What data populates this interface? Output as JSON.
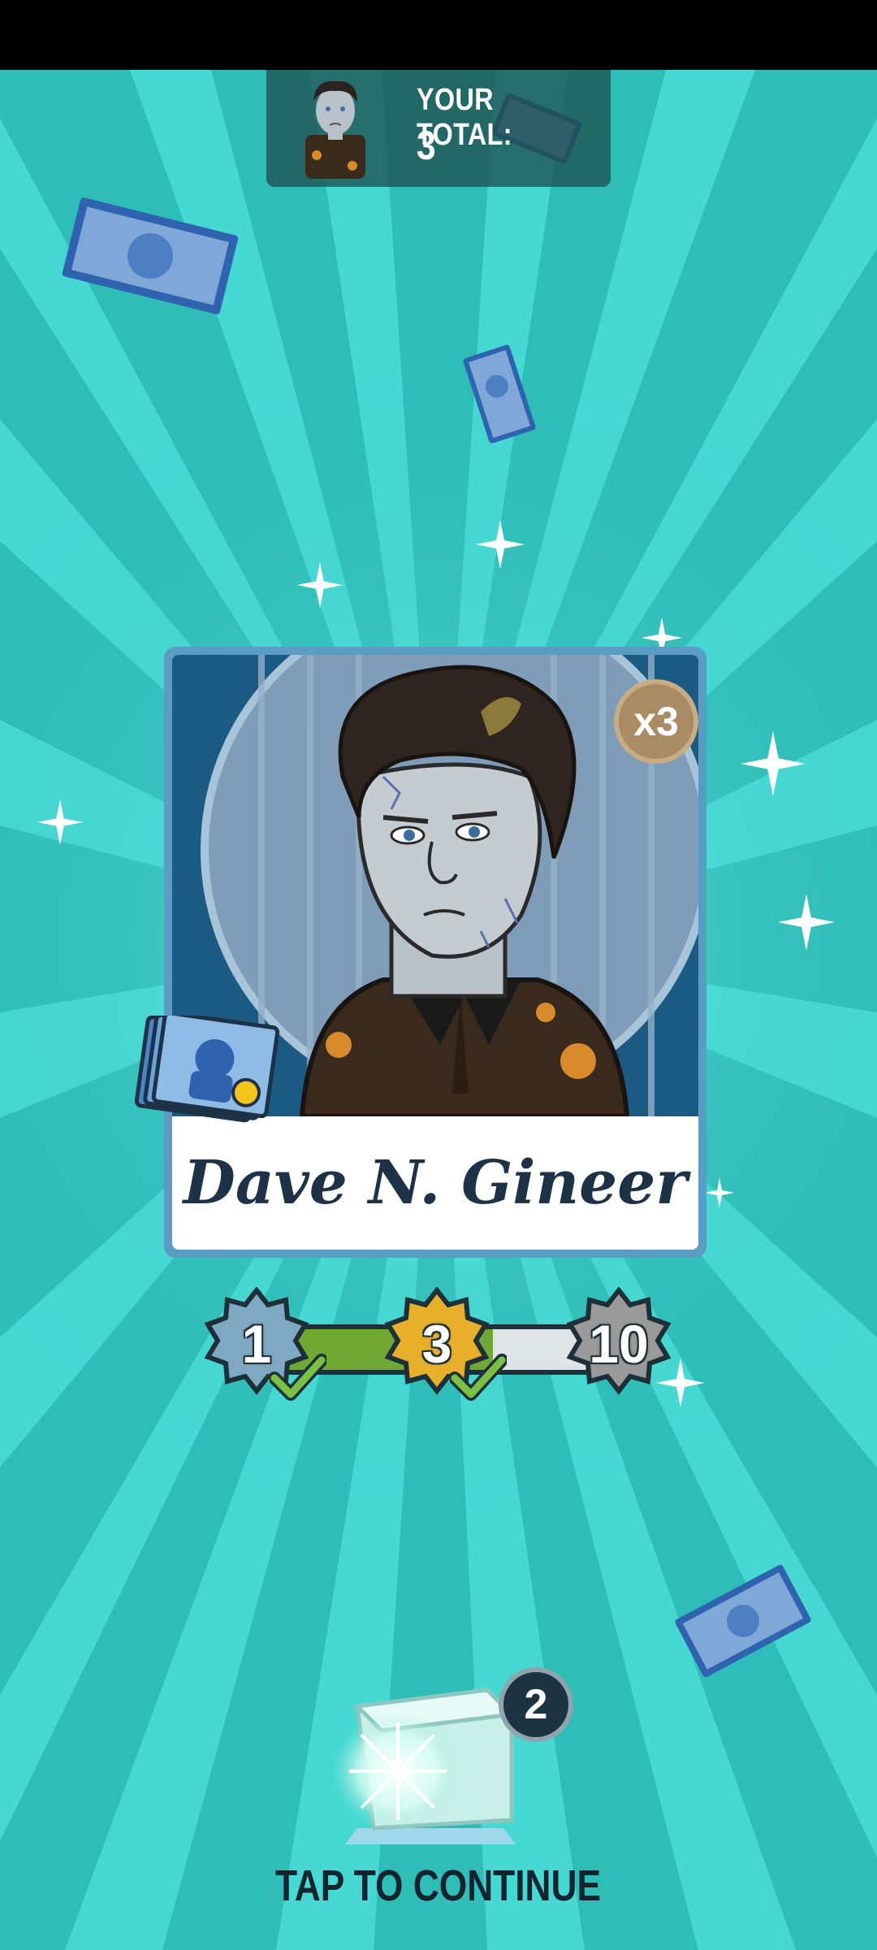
{
  "header": {
    "total_label": "YOUR TOTAL:",
    "total_value": "3"
  },
  "card": {
    "name": "Dave N. Gineer",
    "multiplier": "x3"
  },
  "progress": {
    "levels": [
      "1",
      "3",
      "10"
    ],
    "fill_fraction": 0.63
  },
  "chest": {
    "count": "2"
  },
  "footer": {
    "continue_label": "TAP TO CONTINUE"
  },
  "colors": {
    "background": "#2fbfb9",
    "card_frame": "#5a9cc4",
    "badge_level1": "#7fa9c2",
    "badge_level3": "#e8b02a",
    "badge_level10": "#9a9a9a",
    "progress_fill": "#6fa832"
  }
}
